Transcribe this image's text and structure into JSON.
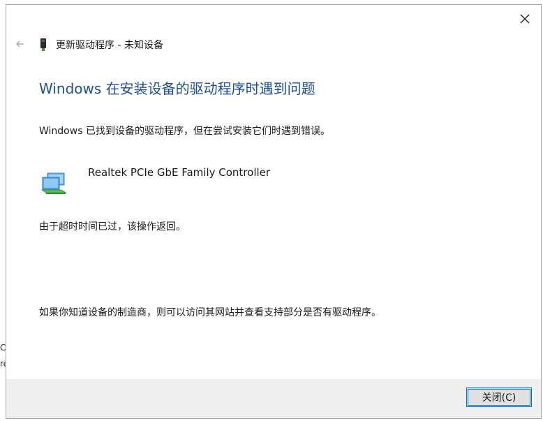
{
  "window": {
    "nav_title": "更新驱动程序 - 未知设备",
    "close_icon": "close-icon",
    "back_icon": "back-arrow-icon"
  },
  "main": {
    "heading": "Windows 在安装设备的驱动程序时遇到问题",
    "found_text": "Windows 已找到设备的驱动程序，但在尝试安装它们时遇到错误。",
    "device_name": "Realtek PCIe GbE Family Controller",
    "device_icon": "network-adapter-icon",
    "error_text": "由于超时时间已过，该操作返回。",
    "hint_text": "如果你知道设备的制造商，则可以访问其网站并查看支持部分是否有驱动程序。"
  },
  "footer": {
    "close_button_label": "关闭(C)"
  },
  "background_edge": {
    "glyph_1": "C",
    "glyph_2": "re"
  },
  "colors": {
    "heading": "#1e4e9a",
    "footer_bg": "#f0f0f0",
    "button_border": "#0078d7"
  }
}
